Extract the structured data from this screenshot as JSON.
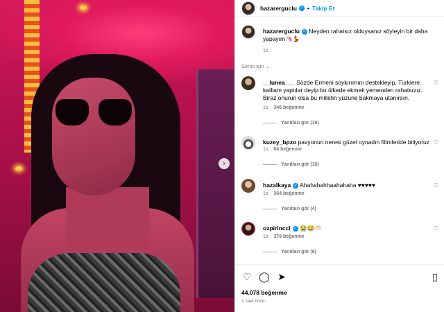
{
  "post": {
    "username": "hazarerguclu",
    "follow_label": "Takip Et",
    "caption_user": "hazarerguclu",
    "caption_text": "Neyden rahatsız olduysanız söyleyin bir daha yapayım🦄💃",
    "caption_time": "1s",
    "sort_label": "Senin için",
    "likes": "44.078 beğenme",
    "posted": "1 saat önce"
  },
  "comments": [
    {
      "user": "__lunea___",
      "text": "Sözde Ermeni soykırımını destekleyip, Türklere katliam yaptılar deyip bu ülkede ekmek yemenden rahatsızız. Biraz onurun olsa bu milletin yüzüne bakmaya utanırsın.",
      "time": "1s",
      "likes": "346 beğenme",
      "replies": "Yanıtları gör (16)"
    },
    {
      "user": "kuzey_bpzo",
      "text": "pavyonun neresi güzel oynadın filimleride biliyoruz",
      "time": "1s",
      "likes": "64 beğenme",
      "replies": "Yanıtları gör (16)"
    },
    {
      "user": "hazalkaya",
      "text": "Ahahahahhaahahaha ♥♥♥♥♥",
      "time": "1s",
      "likes": "364 beğenme",
      "replies": "Yanıtları gör (4)"
    },
    {
      "user": "ozpirincci",
      "text": "😭😂🫶🏻",
      "time": "1s",
      "likes": "379 beğenme",
      "replies": "Yanıtları gör (6)"
    }
  ],
  "icons": {
    "verified": "verified-badge-icon",
    "more": "more-icon",
    "heart": "heart-icon",
    "comment": "comment-icon",
    "share": "share-icon",
    "save": "bookmark-icon",
    "next": "chevron-right-icon"
  },
  "colors": {
    "accent": "#0095f6",
    "muted": "#737373"
  }
}
